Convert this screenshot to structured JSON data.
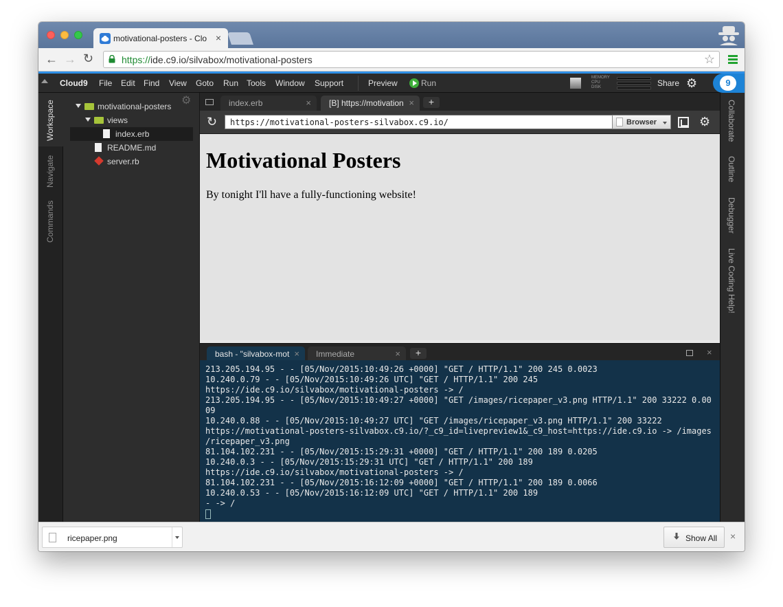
{
  "browser": {
    "tab_title": "motivational-posters - Clo",
    "url_scheme": "https://",
    "url_rest": "ide.c9.io/silvabox/motivational-posters",
    "icons": [
      "back-arrow-icon",
      "forward-arrow-icon",
      "reload-icon",
      "lock-icon",
      "star-icon",
      "menu-icon"
    ],
    "colors": {
      "accent": "#2f8fe6",
      "secure": "#1f8b33"
    }
  },
  "menubar": {
    "brand": "Cloud9",
    "items": [
      "File",
      "Edit",
      "Find",
      "View",
      "Goto",
      "Run",
      "Tools",
      "Window",
      "Support"
    ],
    "preview": "Preview",
    "run": "Run",
    "meters": [
      "MEMORY",
      "CPU",
      "DISK"
    ],
    "share": "Share"
  },
  "left_tabs": [
    "Workspace",
    "Navigate",
    "Commands"
  ],
  "tree": {
    "root": "motivational-posters",
    "folder": "views",
    "files": [
      "index.erb",
      "README.md",
      "server.rb"
    ]
  },
  "editor_tabs": [
    {
      "label": "index.erb"
    },
    {
      "label": "[B] https://motivation"
    }
  ],
  "preview": {
    "url": "https://motivational-posters-silvabox.c9.io/",
    "mode": "Browser",
    "heading": "Motivational Posters",
    "paragraph": "By tonight I'll have a fully-functioning website!"
  },
  "terminal_tabs": [
    {
      "label": "bash - \"silvabox-mot"
    },
    {
      "label": "Immediate"
    }
  ],
  "terminal_lines": [
    "213.205.194.95 - - [05/Nov/2015:10:49:26 +0000] \"GET / HTTP/1.1\" 200 245 0.0023",
    "10.240.0.79 - - [05/Nov/2015:10:49:26 UTC] \"GET / HTTP/1.1\" 200 245",
    "https://ide.c9.io/silvabox/motivational-posters -> /",
    "213.205.194.95 - - [05/Nov/2015:10:49:27 +0000] \"GET /images/ricepaper_v3.png HTTP/1.1\" 200 33222 0.00",
    "09",
    "10.240.0.88 - - [05/Nov/2015:10:49:27 UTC] \"GET /images/ricepaper_v3.png HTTP/1.1\" 200 33222",
    "https://motivational-posters-silvabox.c9.io/?_c9_id=livepreview1&_c9_host=https://ide.c9.io -> /images",
    "/ricepaper_v3.png",
    "81.104.102.231 - - [05/Nov/2015:15:29:31 +0000] \"GET / HTTP/1.1\" 200 189 0.0205",
    "10.240.0.3 - - [05/Nov/2015:15:29:31 UTC] \"GET / HTTP/1.1\" 200 189",
    "https://ide.c9.io/silvabox/motivational-posters -> /",
    "81.104.102.231 - - [05/Nov/2015:16:12:09 +0000] \"GET / HTTP/1.1\" 200 189 0.0066",
    "10.240.0.53 - - [05/Nov/2015:16:12:09 UTC] \"GET / HTTP/1.1\" 200 189",
    "- -> /"
  ],
  "right_tabs": [
    "Collaborate",
    "Outline",
    "Debugger",
    "Live Coding Help!"
  ],
  "downloads": {
    "file": "ricepaper.png",
    "show_all": "Show All"
  }
}
